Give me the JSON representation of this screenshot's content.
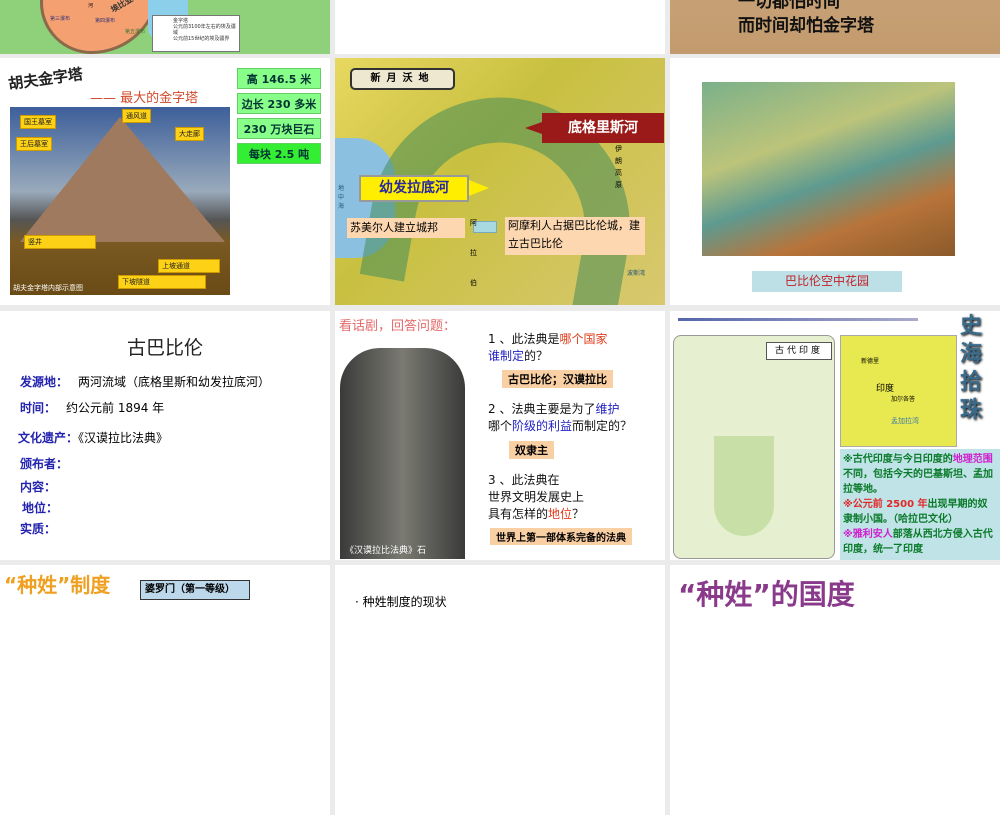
{
  "slides": {
    "egypt_map": {
      "region": "埃比亚",
      "falls": [
        "第三瀑布",
        "第四瀑布",
        "第五瀑布"
      ],
      "legend": [
        "金字塔",
        "公元前3100年左右的埃及疆域",
        "公元前15世纪的埃及疆界"
      ],
      "river": "河"
    },
    "blank": {},
    "pyramid_quote": {
      "line1": "一切都怕时间",
      "line2": "而时间却怕金字塔"
    },
    "khufu": {
      "title": "胡夫金字塔",
      "subtitle": "—— 最大的金字塔",
      "facts": [
        "高 146.5 米",
        "边长 230 多米",
        "230 万块巨石",
        "每块 2.5 吨"
      ],
      "labels": [
        "国王墓室",
        "王后墓室",
        "通风道",
        "大走廊",
        "竖井",
        "上坡通道",
        "下坡隧道"
      ],
      "caption": "胡夫金字塔内部示意图"
    },
    "crescent": {
      "map_title": "新月沃地",
      "tigris": "底格里斯河",
      "euphrates": "幼发拉底河",
      "step1": "苏美尔人建立城邦",
      "step2": "阿摩利人占据巴比伦城，建立古巴比伦",
      "places": [
        "伊朗高原",
        "阿拉伯",
        "地中海",
        "波斯湾"
      ]
    },
    "garden": {
      "caption": "巴比伦空中花园"
    },
    "babylon": {
      "title": "古巴比伦",
      "rows": [
        {
          "k": "发源地：",
          "v": "两河流域（底格里斯和幼发拉底河）"
        },
        {
          "k": "时间：",
          "v": "约公元前 1894 年"
        },
        {
          "k": "文化遗产：",
          "v": "《汉谟拉比法典》"
        },
        {
          "k": "颁布者：",
          "v": ""
        },
        {
          "k": "内容：",
          "v": ""
        },
        {
          "k": "地位：",
          "v": ""
        },
        {
          "k": "实质：",
          "v": ""
        }
      ]
    },
    "code": {
      "heading": "看话剧，回答问题：",
      "q1a": "1 、此法典是",
      "q1b": "哪个国家",
      "q1c": "谁制定",
      "q1d": "的？",
      "a1": "古巴比伦；汉谟拉比",
      "q2a": "2 、法典主要是为了",
      "q2b": "维护",
      "q2c": "哪个",
      "q2d": "阶级的利益",
      "q2e": "而制定的？",
      "a2": "奴隶主",
      "q3a": "3 、此法典在",
      "q3b": "世界文明发展史上",
      "q3c": "具有怎样的",
      "q3d": "地位",
      "q3e": "？",
      "a3": "世界上第一部体系完备的法典",
      "caption": "《汉谟拉比法典》石"
    },
    "india": {
      "map_title": "古代印度",
      "modern": [
        "新德里",
        "印度",
        "加尔各答",
        "孟加拉湾"
      ],
      "side_title": "史海拾珠",
      "p1a": "※古代印度与今日印度的",
      "p1b": "地理范围",
      "p1c": "不同，包括今天的巴基斯坦、孟加拉等地。",
      "p2a": "※公元前 2500 年",
      "p2b": "出现早期的奴隶制小国。（哈拉巴文化）",
      "p3a": "※雅利安人",
      "p3b": "部落从西北方侵入古代印度，统一了印度"
    },
    "caste": {
      "title": "“种姓”制度",
      "box": "婆罗门（第一等级）"
    },
    "caste2": {
      "bullet": "· 种姓制度的现状"
    },
    "caste3": {
      "title": "“种姓”的国度"
    }
  }
}
